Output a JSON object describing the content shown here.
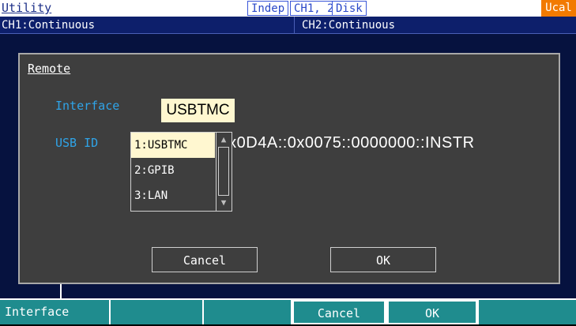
{
  "status_bar": {
    "title": "Utility",
    "indep_tag": "Indep",
    "channels_tag": "CH1, 2",
    "disk_tag": "Disk",
    "ucal_tag": "Ucal",
    "ucal_color": "#f27a00"
  },
  "channels": {
    "ch1": "CH1:Continuous",
    "ch2": "CH2:Continuous"
  },
  "dialog": {
    "title": "Remote",
    "interface_label": "Interface",
    "interface_value": "USBTMC",
    "usb_id_label": "USB ID",
    "usb_id_value": ")x0D4A::0x0075::0000000::INSTR",
    "label_color": "#2fa4e8",
    "dropdown": {
      "options": [
        "1:USBTMC",
        "2:GPIB",
        "3:LAN"
      ],
      "selected": "1:USBTMC",
      "scroll_up_icon": "triangle-up-icon",
      "scroll_down_icon": "triangle-down-icon"
    },
    "cancel_label": "Cancel",
    "ok_label": "OK"
  },
  "softkeys": {
    "key1": "Interface",
    "key2": "",
    "key3": "",
    "key4": "Cancel",
    "key5": "OK",
    "key6": "",
    "color": "#1f8c8e"
  }
}
